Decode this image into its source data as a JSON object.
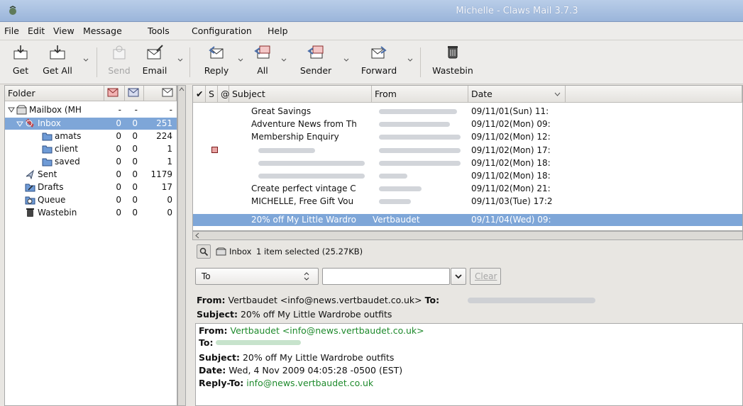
{
  "window": {
    "title": "Michelle - Claws Mail 3.7.3"
  },
  "menu": [
    "File",
    "Edit",
    "View",
    "Message",
    "Tools",
    "Configuration",
    "Help"
  ],
  "toolbar": {
    "get": "Get",
    "get_all": "Get All",
    "send": "Send",
    "email": "Email",
    "reply": "Reply",
    "all": "All",
    "sender": "Sender",
    "forward": "Forward",
    "wastebin": "Wastebin"
  },
  "folders": {
    "header": "Folder",
    "items": [
      {
        "name": "Mailbox (MH",
        "unread": "-",
        "new": "-",
        "total": "-"
      },
      {
        "name": "Inbox",
        "unread": "0",
        "new": "0",
        "total": "251"
      },
      {
        "name": "amats",
        "unread": "0",
        "new": "0",
        "total": "224"
      },
      {
        "name": "client",
        "unread": "0",
        "new": "0",
        "total": "1"
      },
      {
        "name": "saved",
        "unread": "0",
        "new": "0",
        "total": "1"
      },
      {
        "name": "Sent",
        "unread": "0",
        "new": "0",
        "total": "1179"
      },
      {
        "name": "Drafts",
        "unread": "0",
        "new": "0",
        "total": "17"
      },
      {
        "name": "Queue",
        "unread": "0",
        "new": "0",
        "total": "0"
      },
      {
        "name": "Wastebin",
        "unread": "0",
        "new": "0",
        "total": "0"
      }
    ]
  },
  "list": {
    "headers": {
      "check": "✔",
      "status": "S",
      "attach": "@",
      "subject": "Subject",
      "from": "From",
      "date": "Date"
    },
    "rows": [
      {
        "subject": "Great Savings",
        "from": "",
        "date": "09/11/01(Sun) 11:"
      },
      {
        "subject": "Adventure News from Th",
        "from": "",
        "date": "09/11/02(Mon) 09:"
      },
      {
        "subject": "Membership Enquiry",
        "from": "",
        "date": "09/11/02(Mon) 12:"
      },
      {
        "subject": "",
        "from": "",
        "date": "09/11/02(Mon) 17:"
      },
      {
        "subject": "",
        "from": "",
        "date": "09/11/02(Mon) 18:"
      },
      {
        "subject": "",
        "from": "",
        "date": "09/11/02(Mon) 18:"
      },
      {
        "subject": "Create perfect vintage C",
        "from": "",
        "date": "09/11/02(Mon) 21:"
      },
      {
        "subject": "MICHELLE, Free Gift Vou",
        "from": "",
        "date": "09/11/03(Tue) 17:2"
      },
      {
        "subject": "20% off My Little Wardro",
        "from": "Vertbaudet",
        "date": "09/11/04(Wed) 09:"
      }
    ]
  },
  "infobar": {
    "folder": "Inbox",
    "status": "1 item selected (25.27KB)"
  },
  "search": {
    "field": "To",
    "query": "",
    "clear": "Clear"
  },
  "header_view": {
    "from_label": "From:",
    "from": "Vertbaudet <info@news.vertbaudet.co.uk>",
    "to_label": "To:",
    "subject_label": "Subject:",
    "subject": "20% off My Little Wardrobe outfits"
  },
  "message": {
    "from_label": "From:",
    "from": "Vertbaudet <info@news.vertbaudet.co.uk>",
    "to_label": "To:",
    "subject_label": "Subject:",
    "subject": "20% off My Little Wardrobe outfits",
    "date_label": "Date:",
    "date": "Wed, 4 Nov 2009 04:05:28 -0500 (EST)",
    "replyto_label": "Reply-To:",
    "replyto": "info@news.vertbaudet.co.uk"
  }
}
